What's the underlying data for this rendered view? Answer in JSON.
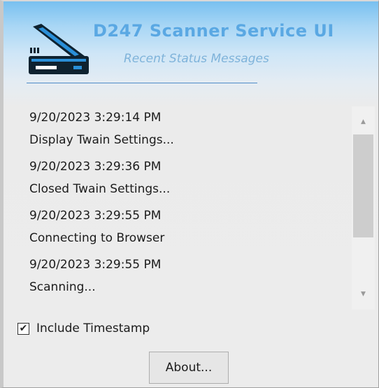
{
  "header": {
    "title": "D247 Scanner Service UI",
    "subtitle": "Recent Status Messages",
    "icon": "scanner-icon"
  },
  "messages": [
    {
      "timestamp": "9/20/2023 3:29:14 PM",
      "text": "Display Twain Settings..."
    },
    {
      "timestamp": "9/20/2023 3:29:36 PM",
      "text": "Closed Twain Settings..."
    },
    {
      "timestamp": "9/20/2023 3:29:55 PM",
      "text": "Connecting to Browser"
    },
    {
      "timestamp": "9/20/2023 3:29:55 PM",
      "text": "Scanning..."
    }
  ],
  "include_timestamp": {
    "label": "Include Timestamp",
    "checked": true
  },
  "about_button": {
    "label": "About..."
  },
  "colors": {
    "title": "#5aa8e3",
    "subtitle": "#7fb3da",
    "header_gradient_top": "#78c0f0",
    "icon_dark": "#0e2230",
    "icon_accent": "#2a8fd8"
  }
}
